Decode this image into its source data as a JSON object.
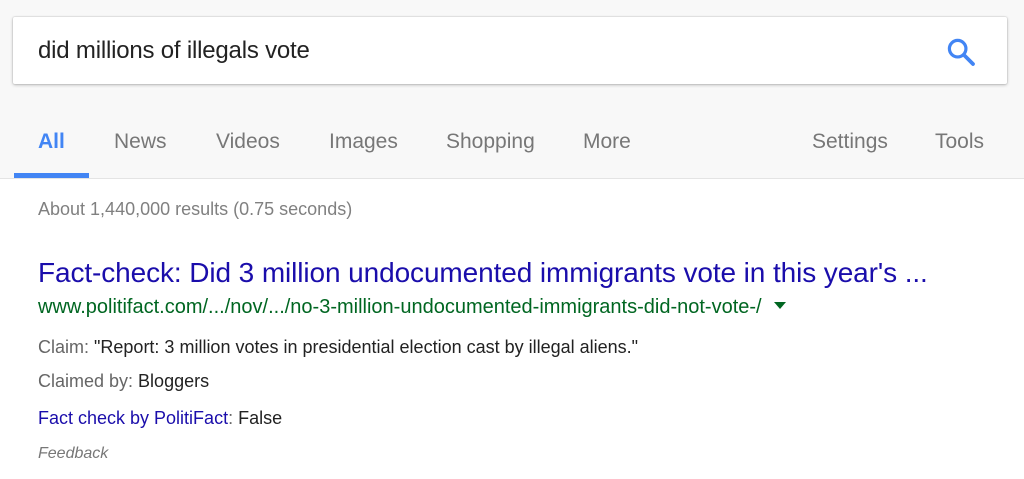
{
  "search": {
    "query": "did millions of illegals vote"
  },
  "tabs": [
    {
      "label": "All",
      "active": true
    },
    {
      "label": "News"
    },
    {
      "label": "Videos"
    },
    {
      "label": "Images"
    },
    {
      "label": "Shopping"
    },
    {
      "label": "More"
    },
    {
      "label": "Settings"
    },
    {
      "label": "Tools"
    }
  ],
  "stats": "About 1,440,000 results (0.75 seconds)",
  "result": {
    "title": "Fact-check: Did 3 million undocumented immigrants vote in this year's ...",
    "url": "www.politifact.com/.../nov/.../no-3-million-undocumented-immigrants-did-not-vote-/",
    "claim_label": "Claim:",
    "claim_text": " \"Report: 3 million votes in presidential election cast by illegal aliens.\"",
    "claimed_by_label": "Claimed by:",
    "claimed_by_text": " Bloggers",
    "fact_check_label": "Fact check by PolitiFact",
    "fact_check_sep": ":",
    "fact_check_rating": " False"
  },
  "feedback": "Feedback",
  "colors": {
    "accent": "#4285f4",
    "title_link": "#1a0dab",
    "url_green": "#006621"
  },
  "icons": {
    "search": "search-icon",
    "url_menu": "caret-down-icon"
  }
}
